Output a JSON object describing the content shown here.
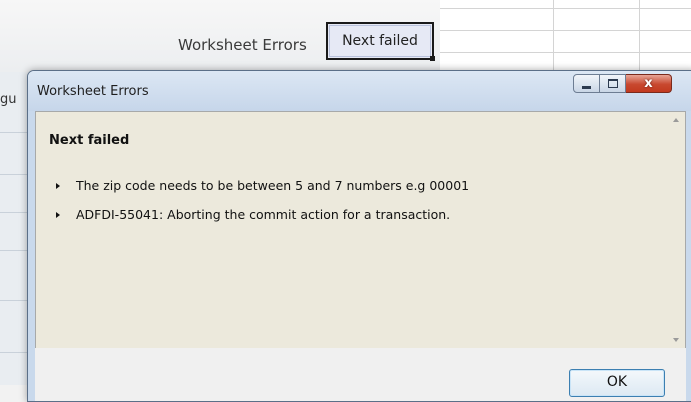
{
  "background": {
    "title": "Worksheet Errors",
    "button_label": "Next failed",
    "left_clipped_text": "gu"
  },
  "dialog": {
    "title": "Worksheet Errors",
    "message_title": "Next failed",
    "messages": [
      "The zip code needs to be between 5 and 7 numbers e.g 00001",
      "ADFDI-55041: Aborting the commit action for a transaction."
    ],
    "ok_label": "OK",
    "window_buttons": {
      "minimize_icon": "minimize-icon",
      "maximize_icon": "maximize-icon",
      "close_icon": "close-icon",
      "close_glyph": "x"
    }
  },
  "colors": {
    "content_background": "#ece9dc",
    "close_button": "#c8482f",
    "titlebar": "#c6d6ea"
  }
}
